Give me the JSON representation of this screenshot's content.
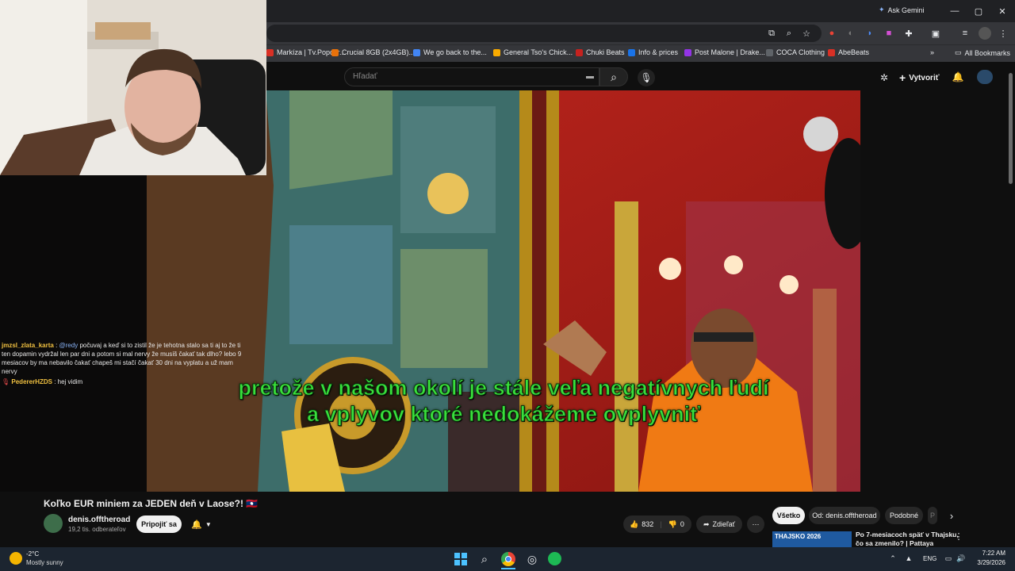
{
  "browser": {
    "ask_gemini": "Ask Gemini",
    "minimize": "—",
    "maximize": "▢",
    "close": "✕",
    "bookmarks": [
      {
        "label": "Markíza | Tv.Popcor...",
        "color": "#d93025"
      },
      {
        "label": "Crucial 8GB (2x4GB)...",
        "color": "#e8710a"
      },
      {
        "label": "We go back to the...",
        "color": "#4285f4"
      },
      {
        "label": "General Tso's Chick...",
        "color": "#f9ab00"
      },
      {
        "label": "Chuki Beats",
        "color": "#c5221f"
      },
      {
        "label": "Info & prices",
        "color": "#1a73e8"
      },
      {
        "label": "Post Malone | Drake...",
        "color": "#9334e6"
      },
      {
        "label": "COCA Clothing",
        "color": "#5f6368"
      },
      {
        "label": "AbeBeats",
        "color": "#d93025"
      }
    ],
    "more_bookmarks": "»",
    "all_bookmarks": "All Bookmarks"
  },
  "youtube": {
    "search_placeholder": "Hľadať",
    "create_label": "Vytvoriť",
    "video": {
      "caption_line1": "pretože v našom okolí je stále veľa negatívnych ľudí",
      "caption_line2": "a vplyvov ktoré nedokážeme ovplyvniť"
    },
    "title": "Koľko EUR miniem za JEDEN deň v Laose?! 🇱🇦",
    "title_flag": "LA",
    "channel": {
      "name": "denis.offtheroad",
      "subscribers": "19,2 tis. odberateľov",
      "join_label": "Pripojiť sa"
    },
    "actions": {
      "likes": "832",
      "dislikes": "0",
      "share_label": "Zdieľať",
      "more": "⋯"
    },
    "chips": [
      "Všetko",
      "Od: denis.offtheroad",
      "Podobné",
      "P"
    ],
    "next_video": {
      "badge": "THAJSKO 2026",
      "title": "Po 7-mesiacoch späť v Thajsku,",
      "title2": "čo sa zmenilo? | Pattaya"
    }
  },
  "chat": [
    {
      "user": "jmzsl_zlata_karta",
      "user_color": "#f0c040",
      "mention": "@redy",
      "text": " počuvaj a keď si to zistil že je tehotna stalo sa ti aj to že ti ten dopamin vydržal len par dni a potom si mal nervy že musíš čakať tak dlho? lebo 9 mesiacov by ma nebavilo čakať chapeš mi stačí čakať 30 dni na vyplatu a už mam nervy"
    },
    {
      "user": "PedererHZDS",
      "user_color": "#f0c040",
      "mention": "",
      "text": ": hej vidim"
    }
  ],
  "taskbar": {
    "weather_temp": "-2°C",
    "weather_text": "Mostly sunny",
    "lang": "ENG",
    "time": "7:22 AM",
    "date": "3/29/2026"
  }
}
